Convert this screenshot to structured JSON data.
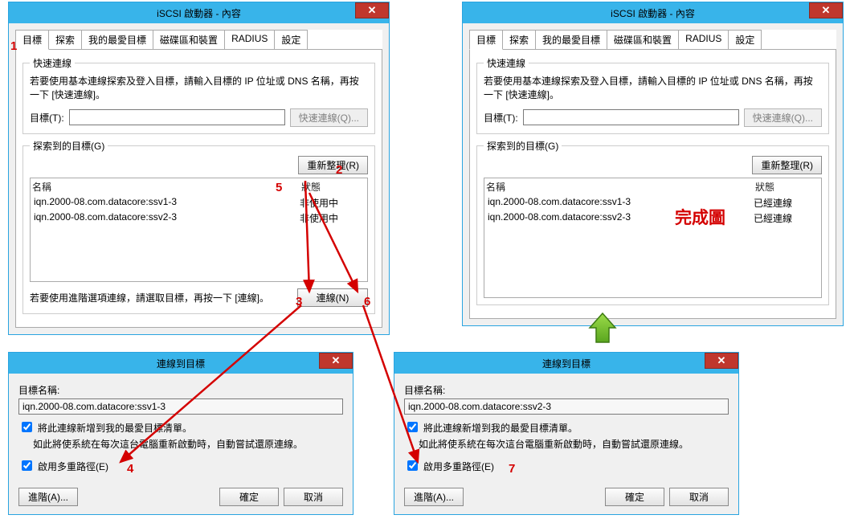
{
  "window_title": "iSCSI 啟動器 - 內容",
  "tabs": [
    "目標",
    "探索",
    "我的最愛目標",
    "磁碟區和裝置",
    "RADIUS",
    "設定"
  ],
  "quick": {
    "legend": "快速連線",
    "instruction": "若要使用基本連線探索及登入目標，請輸入目標的 IP 位址或 DNS 名稱，再按一下 [快速連線]。",
    "target_label": "目標(T):",
    "quick_btn": "快速連線(Q)..."
  },
  "discovered": {
    "legend": "探索到的目標(G)",
    "refresh_btn": "重新整理(R)",
    "col_name": "名稱",
    "col_status": "狀態",
    "rows_left": [
      {
        "name": "iqn.2000-08.com.datacore:ssv1-3",
        "status": "非使用中"
      },
      {
        "name": "iqn.2000-08.com.datacore:ssv2-3",
        "status": "非使用中"
      }
    ],
    "rows_right": [
      {
        "name": "iqn.2000-08.com.datacore:ssv1-3",
        "status": "已經連線"
      },
      {
        "name": "iqn.2000-08.com.datacore:ssv2-3",
        "status": "已經連線"
      }
    ]
  },
  "adv": {
    "text": "若要使用進階選項連線，請選取目標，再按一下 [連線]。",
    "connect_btn": "連線(N)"
  },
  "connect_dialog": {
    "title": "連線到目標",
    "target_label": "目標名稱:",
    "target_left": "iqn.2000-08.com.datacore:ssv1-3",
    "target_right": "iqn.2000-08.com.datacore:ssv2-3",
    "chk_fav": "將此連線新增到我的最愛目標清單。",
    "fav_note": "如此將使系統在每次這台電腦重新啟動時，自動嘗試還原連線。",
    "chk_mpio": "啟用多重路徑(E)",
    "advanced_btn": "進階(A)...",
    "ok_btn": "確定",
    "cancel_btn": "取消"
  },
  "annotations": {
    "n1": "1",
    "n2": "2",
    "n3": "3",
    "n4": "4",
    "n5": "5",
    "n6": "6",
    "n7": "7",
    "done": "完成圖"
  }
}
